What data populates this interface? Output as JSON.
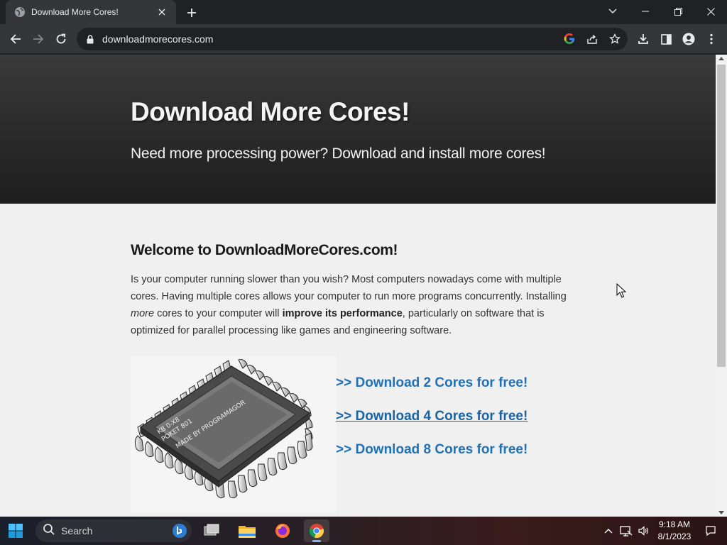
{
  "browser": {
    "tab_title": "Download More Cores!",
    "url": "downloadmorecores.com"
  },
  "hero": {
    "title": "Download More Cores!",
    "subtitle": "Need more processing power? Download and install more cores!"
  },
  "main": {
    "heading": "Welcome to DownloadMoreCores.com!",
    "intro_part1": "Is your computer running slower than you wish? Most computers nowadays come with multiple cores. Having multiple cores allows your computer to run more programs concurrently. Installing ",
    "intro_italic": "more",
    "intro_part2": " cores to your computer will ",
    "intro_bold": "improve its performance",
    "intro_part3": ", particularly on software that is optimized for parallel processing like games and engineering software.",
    "chip_label_1": "KB 0-X8",
    "chip_label_2": "POKET 801",
    "chip_label_3": "MADE BY PROGRAMAGOR",
    "download_links": [
      ">> Download 2 Cores for free!",
      ">> Download 4 Cores for free!",
      ">> Download 8 Cores for free!"
    ]
  },
  "taskbar": {
    "search_label": "Search",
    "time": "9:18 AM",
    "date": "8/1/2023"
  },
  "colors": {
    "link": "#1f72b8",
    "hero_bg": "#2b2b2b",
    "page_bg": "#f0f0f0"
  }
}
